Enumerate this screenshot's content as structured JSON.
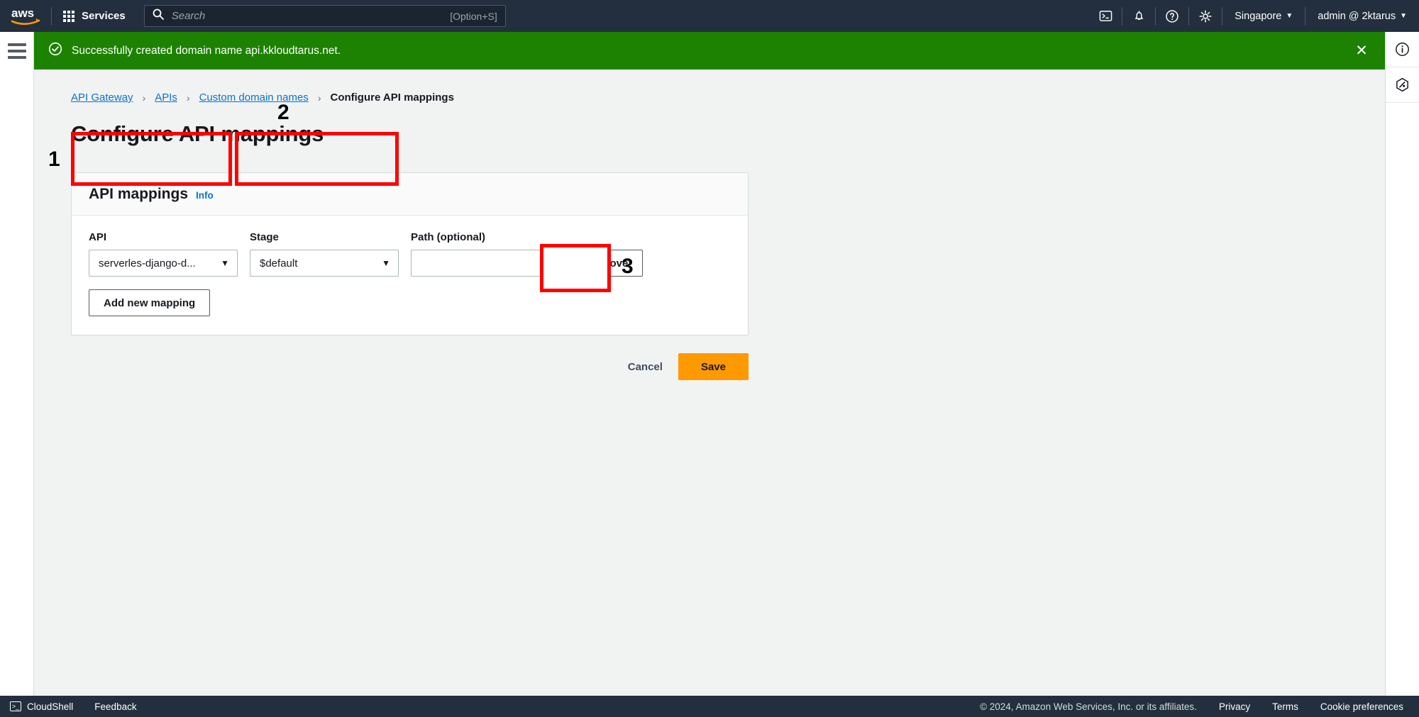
{
  "topnav": {
    "logo": "aws-logo",
    "services_label": "Services",
    "search_placeholder": "Search",
    "search_value": "",
    "search_shortcut": "[Option+S]",
    "icons": [
      "cloudshell-icon",
      "notifications-icon",
      "help-icon",
      "settings-icon"
    ],
    "region_label": "Singapore",
    "account_label": "admin @ 2ktarus",
    "caret": "▼"
  },
  "flash": {
    "message": "Successfully created domain name api.kkloudtarus.net.",
    "close_label": "✕",
    "color": "#1d8102"
  },
  "breadcrumb": {
    "items": [
      {
        "label": "API Gateway",
        "link": true
      },
      {
        "label": "APIs",
        "link": true
      },
      {
        "label": "Custom domain names",
        "link": true
      },
      {
        "label": "Configure API mappings",
        "link": false
      }
    ],
    "separator": "›"
  },
  "page": {
    "title": "Configure API mappings"
  },
  "card": {
    "title": "API mappings",
    "info_label": "Info",
    "fields": {
      "api": {
        "label": "API",
        "value": "serverles-django-d...",
        "caret": "▼"
      },
      "stage": {
        "label": "Stage",
        "value": "$default",
        "caret": "▼"
      },
      "path": {
        "label": "Path (optional)",
        "value": "",
        "placeholder": ""
      }
    },
    "remove_label": "Remove",
    "add_mapping_label": "Add new mapping"
  },
  "actions": {
    "cancel_label": "Cancel",
    "save_label": "Save",
    "save_color": "#ff9900"
  },
  "annotations": {
    "color": "#ff0000",
    "items": [
      {
        "number": "1",
        "target": "api-field"
      },
      {
        "number": "2",
        "target": "stage-field"
      },
      {
        "number": "3",
        "target": "save-button"
      }
    ]
  },
  "rightrail": {
    "icons": [
      "info-icon",
      "settings-hex-icon"
    ]
  },
  "footer": {
    "cloudshell_label": "CloudShell",
    "feedback_label": "Feedback",
    "copyright": "© 2024, Amazon Web Services, Inc. or its affiliates.",
    "privacy_label": "Privacy",
    "terms_label": "Terms",
    "cookie_label": "Cookie preferences"
  }
}
